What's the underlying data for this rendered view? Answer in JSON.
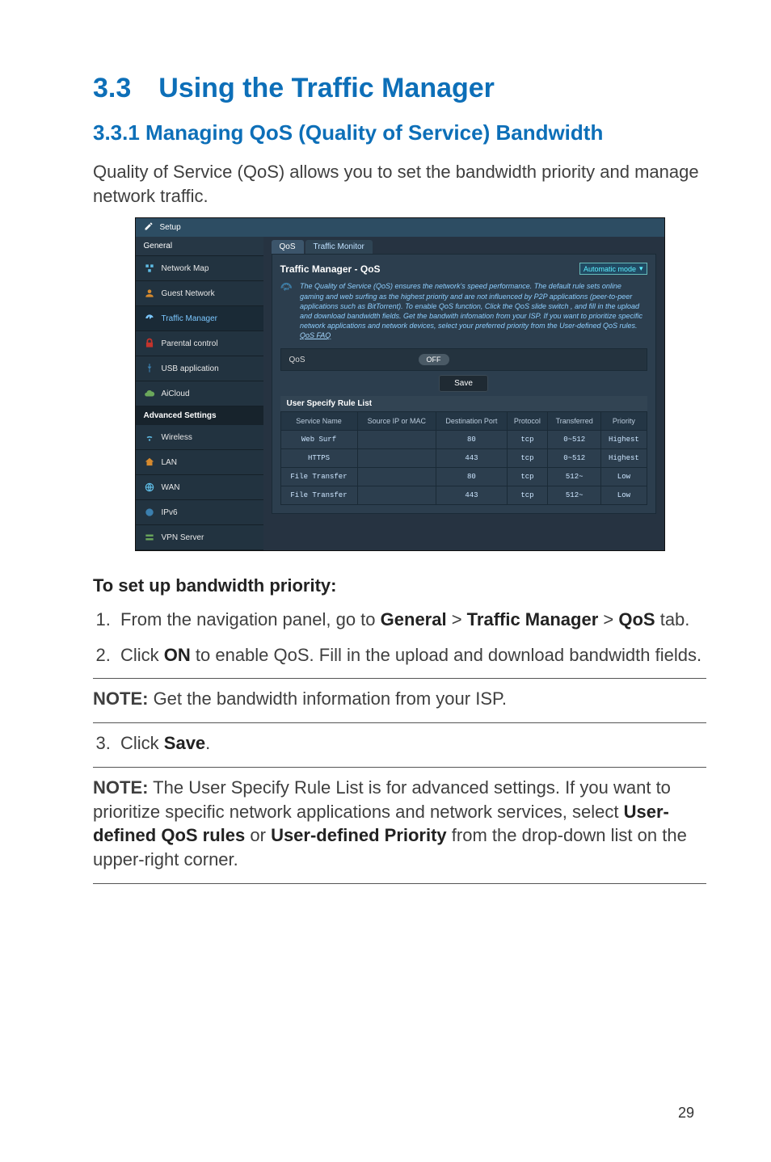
{
  "section_title": "3.3 Using the Traffic Manager",
  "subsection_title": "3.3.1 Managing QoS (Quality of Service) Bandwidth",
  "intro": "Quality of Service (QoS) allows you to set the bandwidth priority and manage network traffic.",
  "steps_heading": "To set up bandwidth priority:",
  "steps": {
    "s1_a": "From the navigation panel, go to ",
    "s1_b": "General",
    "s1_gt1": " > ",
    "s1_c": "Traffic Manager",
    "s1_gt2": " > ",
    "s1_d": "QoS",
    "s1_e": " tab.",
    "s2_a": "Click ",
    "s2_b": "ON",
    "s2_c": " to enable QoS. Fill in the upload and download bandwidth fields.",
    "s3_a": "Click ",
    "s3_b": "Save",
    "s3_c": "."
  },
  "note1_label": "NOTE:",
  "note1_text": " Get the bandwidth information from your ISP.",
  "note2_label": "NOTE:",
  "note2_a": "   The User Specify Rule List is for advanced settings. If you want to prioritize specific network applications and network services, select ",
  "note2_b": "User-defined QoS rules",
  "note2_or": " or ",
  "note2_c": "User-defined Priority",
  "note2_d": " from the drop-down list on the upper-right corner.",
  "page_number": "29",
  "shot": {
    "setup_label": "Setup",
    "sidebar_general": "General",
    "sidebar_items": [
      "Network Map",
      "Guest Network",
      "Traffic Manager",
      "Parental control",
      "USB application",
      "AiCloud"
    ],
    "sidebar_adv": "Advanced Settings",
    "sidebar_adv_items": [
      "Wireless",
      "LAN",
      "WAN",
      "IPv6",
      "VPN Server"
    ],
    "tabs": {
      "qos": "QoS",
      "monitor": "Traffic Monitor"
    },
    "panel_title": "Traffic Manager - QoS",
    "mode_label": "Automatic mode",
    "desc": "The Quality of Service (QoS) ensures the network's speed performance. The default rule sets online gaming and web surfing as the highest priority and are not influenced by P2P applications (peer-to-peer applications such as BitTorrent). To enable QoS function, Click the QoS slide switch , and fill in the upload and download bandwidth fields. Get the bandwith infomation from your ISP. If you want to prioritize specific network applications and network devices, select your preferred priority from the User-defined QoS rules.",
    "faq_link": "QoS FAQ",
    "qos_label": "QoS",
    "toggle_value": "OFF",
    "save_label": "Save",
    "rule_list_header": "User Specify Rule List",
    "rule_headers": [
      "Service Name",
      "Source IP or MAC",
      "Destination Port",
      "Protocol",
      "Transferred",
      "Priority"
    ],
    "rules": [
      {
        "name": "Web Surf",
        "ip": "",
        "port": "80",
        "proto": "tcp",
        "trans": "0~512",
        "prio": "Highest"
      },
      {
        "name": "HTTPS",
        "ip": "",
        "port": "443",
        "proto": "tcp",
        "trans": "0~512",
        "prio": "Highest"
      },
      {
        "name": "File Transfer",
        "ip": "",
        "port": "80",
        "proto": "tcp",
        "trans": "512~",
        "prio": "Low"
      },
      {
        "name": "File Transfer",
        "ip": "",
        "port": "443",
        "proto": "tcp",
        "trans": "512~",
        "prio": "Low"
      }
    ]
  }
}
